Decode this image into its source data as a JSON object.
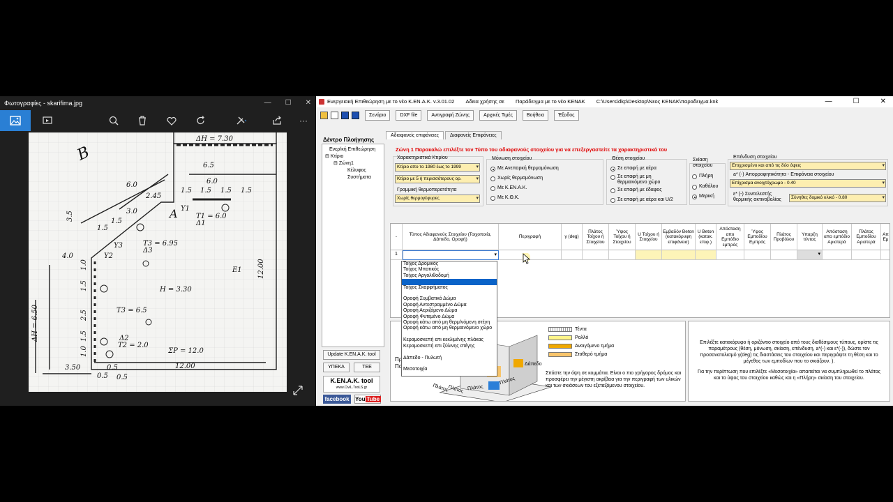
{
  "photos": {
    "title": "Φωτογραφίες - skarifima.jpg",
    "window_icons": [
      "minimize-icon",
      "maximize-icon",
      "close-icon"
    ],
    "toolbar_icons": [
      "image-icon",
      "slideshow-icon",
      "zoom-icon",
      "delete-icon",
      "heart-icon",
      "rotate-icon",
      "edit-icon",
      "share-icon",
      "more-icon"
    ],
    "sketch": {
      "top_label": "ΔH = 7.30",
      "left_label": "ΔH = 6.50",
      "labels": [
        "Y1",
        "Y2",
        "Y3",
        "A",
        "Δ1",
        "T1 = 6.0",
        "T3 = 6.95",
        "Δ3",
        "H = 3.30",
        "T3 = 6.5",
        "Δ2",
        "T2 = 2.0",
        "E1",
        "ΣP = 12.0",
        "12.00",
        "12.00",
        "3.50",
        "6.0",
        "6.0",
        "1.5",
        "1.5",
        "1.5",
        "1.5",
        "2.45",
        "3.0",
        "1.5",
        "1.5",
        "6.5",
        "3.5",
        "4.0",
        "1.0",
        "1.5",
        "2.5",
        "1.5",
        "1.0",
        "0.5",
        "0.5",
        "0.5",
        "B"
      ]
    }
  },
  "app": {
    "title_parts": [
      "Ενεργειακή Επιθεώρηση με το νέο Κ.ΕΝ.Α.Κ. v.3.01.02",
      "Αδεια χρήσης σε",
      "Παράδειγμα με το νέο KENAK",
      "C:\\Users\\dkp\\Desktop\\Νεος KENAK\\παραδειγμα.knk"
    ],
    "toolbar": [
      "Σενάριο",
      "DXF file",
      "Αντιγραφή Ζώνης",
      "Αρχικές Τιμές",
      "Βοήθεια",
      "Έξοδος"
    ],
    "tree_title": "Δέντρο Πλοήγησης",
    "tree_items": [
      "Ενερ/κή Επιθεώρηση",
      "Κτίριο",
      "Ζώνη1",
      "Κέλυφος",
      "Συστήματα"
    ],
    "left_buttons": {
      "update": "Update K.EN.A.K. tool",
      "ypeka": "ΥΠΕΚΑ",
      "tee": "TEE"
    },
    "logo": {
      "main": "K.EN.A.K. tool",
      "sub": "www.CiviL.TooLS.gr"
    },
    "social": {
      "facebook": "facebook",
      "youtube_a": "You",
      "youtube_b": "Tube"
    },
    "tabs": [
      "Αδιαφανείς επιφάνειες",
      "Διαφανείς Επιφάνειες"
    ],
    "zone_line": "Ζώνη 1  Παρακαλώ επιλέξτε τον Τύπο του αδιαφανούς στοιχείου για να επεξεργαστείτε τα χαρακτηριστικά του",
    "building": {
      "label": "Χαρακτηριστικά Κτιρίου",
      "year": "Κτίριο απο το 1980 έως το 1999",
      "floors": "Κτίριο με 5 ή περισσότερους ορ.",
      "bridge_label": "Γραμμική θερμοπερατότητα",
      "bridge": "Χωρίς θερμογέφυρες"
    },
    "insulation": {
      "label": "Μόνωση στοιχείου",
      "options": [
        "Με Ανεπαρκή θερμομόνωση",
        "Χωρίς θερμομόνωση",
        "Με Κ.ΕΝ.Α.Κ.",
        "Με Κ.Θ.Κ."
      ],
      "selected": 0
    },
    "position": {
      "label": "Θέση στοιχείου",
      "options": [
        "Σε επαφή με αέρα",
        "Σε επαφή με μη θερμαινόμενο χώρο",
        "Σε επαφή με έδαφος",
        "Σε επαφή με αέρα και U/2"
      ],
      "selected": 0
    },
    "shading": {
      "label": "Σκίαση στοιχείου",
      "options": [
        "Πλήρη",
        "Καθόλου",
        "Μερική"
      ],
      "selected": 2
    },
    "coating": {
      "label": "Επένδυση στοιχείου",
      "value": "Επιχρισμένο και από τις δύο όψεις",
      "alpha_label": "a* (-) Απορροφητικότητα - Επιφάνεια στοιχείου",
      "alpha_value": "Επίχρισμα ανοιχτόχρωμο - 0.40",
      "eps_label": "ε* (-) Συντελεστής θερμικής ακτινοβολίας",
      "eps_value": "Σύνηθες δομικό υλικό - 0.80"
    },
    "grid": {
      "headers": [
        "-",
        "Τύπος Αδιαφανούς Στοιχείου (Τοιχοποιία, Δάπεδο, Οροφή)",
        "Περιγραφή",
        "γ (deg)",
        "Πλάτος Τοίχου ή Στοιχείου",
        "Ύψος Τοίχου ή Στοιχείου",
        "U Τοίχου ή Στοιχείου",
        "Εμβαδόν Beton (κατακόρυφη επιφάνεια)",
        "U Beton (κατακ. επιφ.)",
        "Απόσταση απο Εμπόδιο εμπρός",
        "Ύψος Εμποδίου Εμπρός",
        "Πλάτος Προβόλου",
        "Υπαρξη τέντας",
        "Απόσταση απο εμπόδιο Αριστερά",
        "Πλάτος Εμποδίου Αριστερά",
        "Απ Εμ"
      ],
      "row_number": "1"
    },
    "dropdown_items": [
      "Τοίχος Δρομικός",
      "Τοίχος Μπατικός",
      "Τοίχος Αργολιθοδομή",
      "",
      "Τοίχος Σκαρφήματος",
      "",
      "Οροφή Συμβατικό Δώμα",
      "Οροφή Αντεστραμμένο Δώμα",
      "Οροφή Αεριζόμενο Δώμα",
      "Οροφή Φυτεμένο Δώμα",
      "Οροφή κάτω από μη θερμ/νόμενη στέγη",
      "Οροφή κάτω από μη θερμαινόμενο χώρο",
      "",
      "Κεραμοσκεπή επι κεκλιμένης πλάκας",
      "Κεραμοσκεπή επι ξύλινης στέγης",
      "",
      "Δάπεδο - Πυλωτή",
      "",
      "Μεσοτοιχία"
    ],
    "dropdown_selected": 3,
    "legend": [
      "Τέντα",
      "Ρολλό",
      "Ανοιγόμενο τμήμα",
      "Σταθερό τμήμα"
    ],
    "legend_colors": [
      "#d9d9d9",
      "#fff58a",
      "#f0a800",
      "#f7c46b"
    ],
    "diagram_labels": [
      "Δάπεδο",
      "Πλάτος",
      "Πλάτος",
      "Πλάτος",
      "Πλάτος"
    ],
    "diagram_text": "Σπάστε την όψη σε κομμάτια. Είναι ο πιο γρήγορος δρόμος και προσφέρει την μέγιστη ακρίβεια για την περιγραφή των υλικών και των σκιάσεων του εξεταζόμενου στοιχείου.",
    "diagram_left_text": [
      "Πρ",
      "Πο"
    ],
    "help_text_1": "Επιλέξτε κατακόρυφο ή οριζόντιο στοιχείο από τους διαθέσιμους τύπους, ορίστε τις παραμέτρους (θέση, μόνωση, σκίαση, επένδυση, a*(-) και ε*(-)), δώστε τον προσανατολισμό γ(deg) τις διαστάσεις του στοιχείου και περιγράψτε τη θέση και το μέγεθος των εμποδίων που το σκιάζουν. ).",
    "help_text_2": "Για την περίπτωση που επιλέξτε «Μεσοτοιχία» απαιτείται να συμπληρωθεί το πλάτος και το ύψος του στοιχείου καθώς και η «Πλήρη» σκίαση του στοιχείου."
  }
}
